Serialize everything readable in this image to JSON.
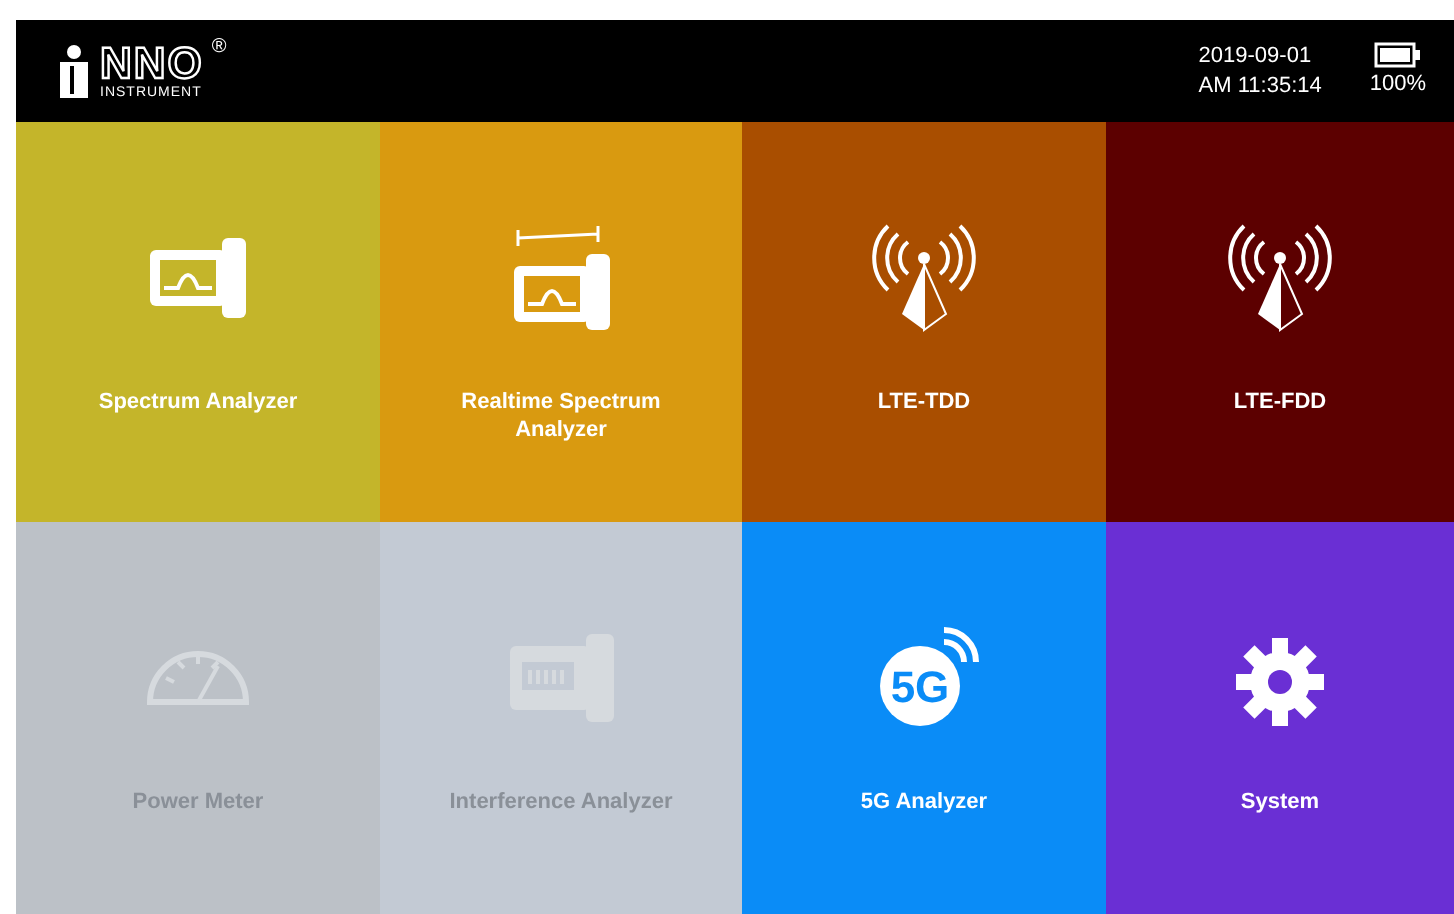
{
  "header": {
    "logo": {
      "wordmark": "NNO",
      "subtitle": "INSTRUMENT",
      "registered": "®"
    },
    "date": "2019-09-01",
    "time": "AM 11:35:14",
    "battery": "100%"
  },
  "tiles": [
    {
      "label": "Spectrum Analyzer",
      "kind": "analyzer",
      "color": "#c4b52a",
      "disabled": false
    },
    {
      "label": "Realtime Spectrum Analyzer",
      "kind": "realtime",
      "color": "#d99a10",
      "disabled": false
    },
    {
      "label": "LTE-TDD",
      "kind": "antenna",
      "color": "#a94e00",
      "disabled": false
    },
    {
      "label": "LTE-FDD",
      "kind": "antenna",
      "color": "#5c0000",
      "disabled": false
    },
    {
      "label": "Power Meter",
      "kind": "meter",
      "color": "#bcc1c7",
      "disabled": true
    },
    {
      "label": "Interference Analyzer",
      "kind": "interference",
      "color": "#c3cad4",
      "disabled": true
    },
    {
      "label": "5G Analyzer",
      "kind": "fiveg",
      "color": "#0a8cf7",
      "disabled": false,
      "badge": "5G"
    },
    {
      "label": "System",
      "kind": "gear",
      "color": "#6a2fd4",
      "disabled": false
    }
  ]
}
